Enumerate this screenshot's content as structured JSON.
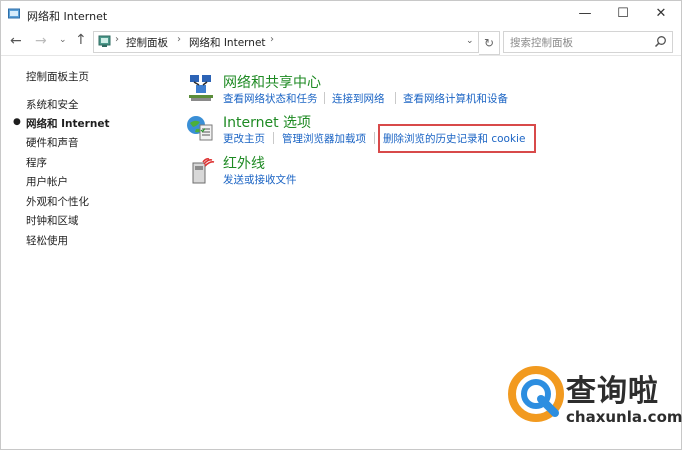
{
  "window": {
    "title": "网络和 Internet",
    "minimize_glyph": "—",
    "maximize_glyph": "☐",
    "close_glyph": "✕"
  },
  "navbar": {
    "breadcrumbs": [
      "控制面板",
      "网络和 Internet"
    ],
    "search_placeholder": "搜索控制面板"
  },
  "sidebar": {
    "items": [
      {
        "label": "控制面板主页",
        "active": false
      },
      {
        "label": "系统和安全",
        "active": false
      },
      {
        "label": "网络和 Internet",
        "active": true
      },
      {
        "label": "硬件和声音",
        "active": false
      },
      {
        "label": "程序",
        "active": false
      },
      {
        "label": "用户帐户",
        "active": false
      },
      {
        "label": "外观和个性化",
        "active": false
      },
      {
        "label": "时钟和区域",
        "active": false
      },
      {
        "label": "轻松使用",
        "active": false
      }
    ]
  },
  "main": {
    "categories": [
      {
        "title": "网络和共享中心",
        "icon": "network-sharing-icon",
        "tasks": [
          "查看网络状态和任务",
          "连接到网络",
          "查看网络计算机和设备"
        ]
      },
      {
        "title": "Internet 选项",
        "icon": "internet-options-icon",
        "tasks": [
          "更改主页",
          "管理浏览器加载项",
          "删除浏览的历史记录和 cookie"
        ]
      },
      {
        "title": "红外线",
        "icon": "infrared-icon",
        "tasks": [
          "发送或接收文件"
        ]
      }
    ]
  },
  "watermark": {
    "title": "查询啦",
    "url": "chaxunla.com"
  },
  "colors": {
    "category_title": "#1e8a23",
    "link": "#1b64c4",
    "highlight_box": "#d84a4a",
    "watermark_orange": "#f29a1f",
    "watermark_blue": "#2d8ee0"
  }
}
